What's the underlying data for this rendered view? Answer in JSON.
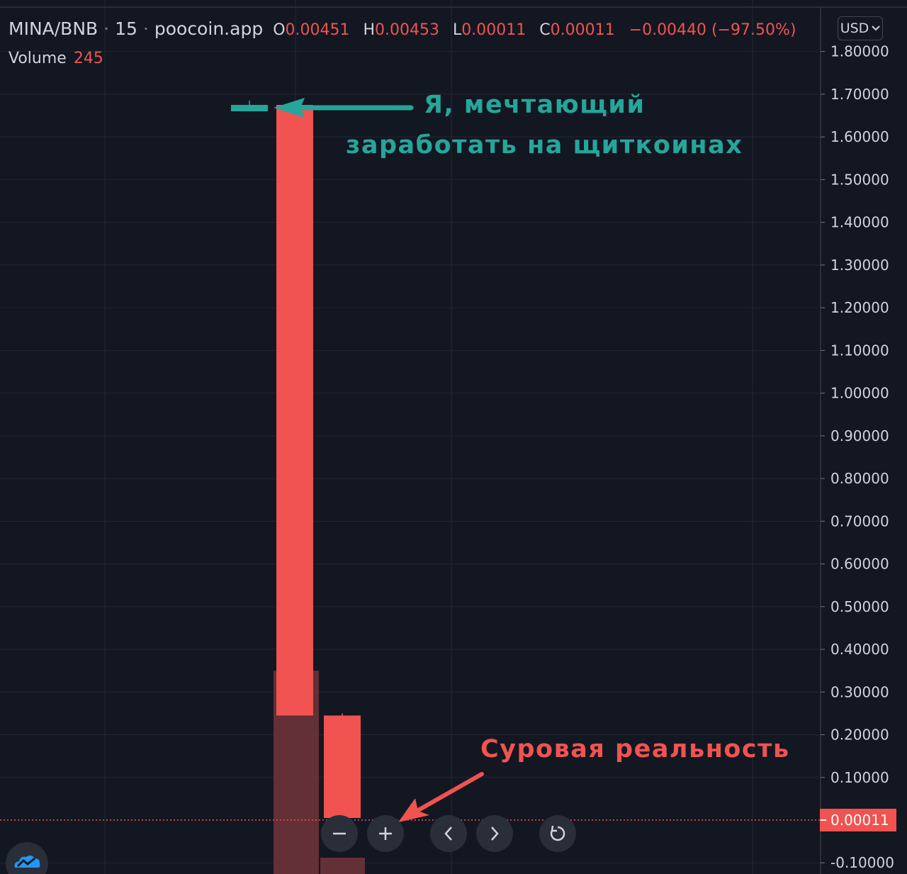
{
  "legend": {
    "symbol": "MINA/BNB",
    "interval": "15",
    "source": "poocoin.app",
    "open_key": "O",
    "open": "0.00451",
    "high_key": "H",
    "high": "0.00453",
    "low_key": "L",
    "low": "0.00011",
    "close_key": "C",
    "close": "0.00011",
    "change": "−0.00440 (−97.50%)"
  },
  "volume": {
    "label": "Volume",
    "value": "245"
  },
  "currency": {
    "label": "USD",
    "chevron": "chevron-down-icon"
  },
  "annotations": {
    "green_line1": "Я, мечтающий",
    "green_line2": "заработать на щиткоинах",
    "red": "Суровая реальность"
  },
  "controls": {
    "zoom_out": "minus-icon",
    "zoom_in": "plus-icon",
    "scroll_left": "chevron-left-icon",
    "scroll_right": "chevron-right-icon",
    "reset": "reset-icon",
    "logo": "tradingview-cloud-icon"
  },
  "colors": {
    "background": "#131722",
    "grid": "#232733",
    "up": "#26a69a",
    "down": "#f05350",
    "volume_down": "#6b3339",
    "text": "#d1d4dc"
  },
  "chart_data": {
    "type": "candlestick",
    "symbol": "MINA/BNB",
    "interval": "15",
    "y_axis": {
      "ticks": [
        "1.80000",
        "1.70000",
        "1.60000",
        "1.50000",
        "1.40000",
        "1.30000",
        "1.20000",
        "1.10000",
        "1.00000",
        "0.90000",
        "0.80000",
        "0.70000",
        "0.60000",
        "0.50000",
        "0.40000",
        "0.30000",
        "0.20000",
        "0.10000",
        "-0.10000"
      ],
      "tick_values": [
        1.8,
        1.7,
        1.6,
        1.5,
        1.4,
        1.3,
        1.2,
        1.1,
        1.0,
        0.9,
        0.8,
        0.7,
        0.6,
        0.5,
        0.4,
        0.3,
        0.2,
        0.1,
        -0.1
      ],
      "range": [
        -0.12,
        1.87
      ],
      "last_price_label": "0.00011",
      "last_price": 0.00011
    },
    "candles": [
      {
        "open": 1.66,
        "high": 1.685,
        "low": 1.66,
        "close": 1.675,
        "direction": "up"
      },
      {
        "open": 1.675,
        "high": 1.675,
        "low": 0.245,
        "close": 0.245,
        "direction": "down"
      },
      {
        "open": 0.245,
        "high": 0.25,
        "low": 0.005,
        "close": 0.005,
        "direction": "down"
      },
      {
        "open": 0.005,
        "high": 0.00453,
        "low": 0.00011,
        "close": 0.00011,
        "direction": "down"
      }
    ],
    "volume_bars": [
      {
        "value": 0,
        "direction": "up"
      },
      {
        "value": 0.35,
        "direction": "down"
      },
      {
        "value": -0.09,
        "direction": "down"
      },
      {
        "value": 0,
        "direction": "down"
      }
    ]
  }
}
